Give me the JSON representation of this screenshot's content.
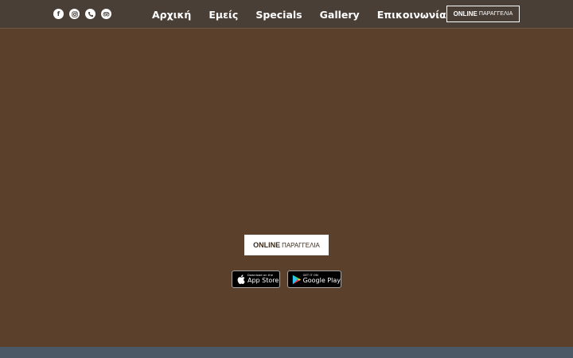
{
  "social": [
    {
      "name": "facebook-icon",
      "glyph": "f"
    },
    {
      "name": "instagram-icon",
      "glyph": ""
    },
    {
      "name": "phone-icon",
      "glyph": ""
    },
    {
      "name": "tripadvisor-icon",
      "glyph": ""
    }
  ],
  "nav": {
    "items": [
      "Αρχική",
      "Εμείς",
      "Specials",
      "Gallery",
      "Επικοινωνία"
    ]
  },
  "header_order": {
    "bold": "ONLINE",
    "small": "ΠΑΡΑΓΓΕΛΙΑ"
  },
  "main_order": {
    "bold": "ONLINE",
    "small": "ΠΑΡΑΓΓΕΛΙΑ"
  },
  "app_store": {
    "small": "Download on the",
    "big": "App Store"
  },
  "google_play": {
    "small": "GET IT ON",
    "big": "Google Play"
  },
  "colors": {
    "background": "#5b412b",
    "header": "#4a3f36",
    "footer": "#4b5866",
    "accent_text": "#ffffff"
  }
}
